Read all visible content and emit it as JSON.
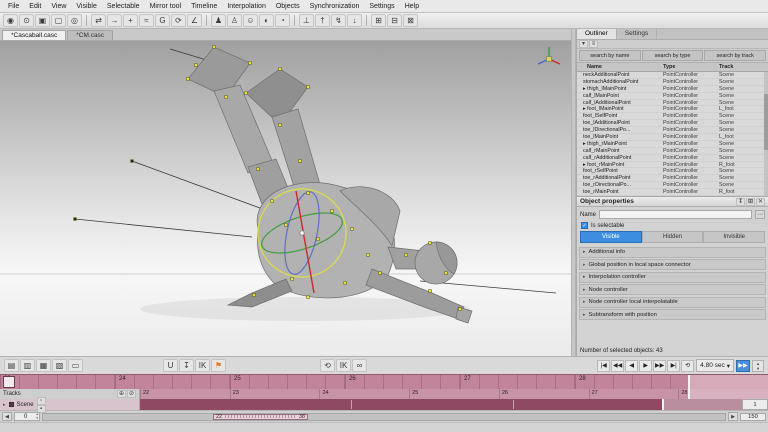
{
  "icons": {
    "chevron": "▸",
    "check": "✓",
    "ellipsis": "⋯",
    "dropdown": "▾",
    "up": "▴",
    "down": "▾",
    "left": "◀",
    "right": "▶"
  },
  "menu": {
    "items": [
      "File",
      "Edit",
      "View",
      "Visible",
      "Selectable",
      "Mirror tool",
      "Timeline",
      "Interpolation",
      "Objects",
      "Synchronization",
      "Settings",
      "Help"
    ]
  },
  "toolbar": {
    "icons": [
      {
        "name": "select-point-mode",
        "glyph": "◉"
      },
      {
        "name": "select-sphere-mode",
        "glyph": "⊙"
      },
      {
        "name": "select-box-mode",
        "glyph": "▣"
      },
      {
        "name": "select-rect-mode",
        "glyph": "▢"
      },
      {
        "name": "camera-view",
        "glyph": "◎"
      },
      {
        "sep": true
      },
      {
        "name": "interval-edit",
        "glyph": "⇄"
      },
      {
        "name": "arrow-select",
        "glyph": "→"
      },
      {
        "name": "move-tool",
        "glyph": "+"
      },
      {
        "name": "trajectory-tool",
        "glyph": "≈"
      },
      {
        "name": "graph-editor",
        "glyph": "G"
      },
      {
        "name": "rotate-tool",
        "glyph": "⟳"
      },
      {
        "name": "angle-snap",
        "glyph": "∠"
      },
      {
        "sep": true
      },
      {
        "name": "pose-mode",
        "glyph": "♟"
      },
      {
        "name": "character-mode",
        "glyph": "♙"
      },
      {
        "name": "ghost-skin",
        "glyph": "☺"
      },
      {
        "name": "mirror-pose",
        "glyph": "◐"
      },
      {
        "name": "onion-skin",
        "glyph": "◔"
      },
      {
        "sep": true
      },
      {
        "name": "ground-contact",
        "glyph": "⊥"
      },
      {
        "name": "tpose-reset",
        "glyph": "†"
      },
      {
        "name": "physics-sim",
        "glyph": "↯"
      },
      {
        "name": "gravity-drop",
        "glyph": "↓"
      },
      {
        "sep": true
      },
      {
        "name": "panel-layout-a",
        "glyph": "⊞"
      },
      {
        "name": "panel-layout-b",
        "glyph": "⊟"
      },
      {
        "name": "panel-layout-c",
        "glyph": "⊠"
      }
    ]
  },
  "tabs": [
    {
      "label": "*Cascaball.casc",
      "active": true
    },
    {
      "label": "*CM.casc",
      "active": false
    }
  ],
  "outliner": {
    "tabs": [
      "Outliner",
      "Settings"
    ],
    "toolbar_icons": [
      {
        "name": "filter-menu",
        "glyph": "▾"
      },
      {
        "name": "view-options",
        "glyph": "≡"
      }
    ],
    "search_buttons": [
      "search by name",
      "search by type",
      "search by track"
    ],
    "columns": [
      "Name",
      "Type",
      "Track"
    ],
    "rows": [
      {
        "arrow": "",
        "name": "neckAdditionalPoint",
        "type": "PointController",
        "track": "Scene"
      },
      {
        "arrow": "",
        "name": "stomachAdditionalPoint",
        "type": "PointController",
        "track": "Scene"
      },
      {
        "arrow": "▸",
        "name": "thigh_lMainPoint",
        "type": "PointController",
        "track": "Scene"
      },
      {
        "arrow": "",
        "name": "calf_lMainPoint",
        "type": "PointController",
        "track": "Scene"
      },
      {
        "arrow": "",
        "name": "calf_lAdditionalPoint",
        "type": "PointController",
        "track": "Scene"
      },
      {
        "arrow": "▸",
        "name": "foot_lMainPoint",
        "type": "PointController",
        "track": "L_foot"
      },
      {
        "arrow": "",
        "name": "foot_lSelfPoint",
        "type": "PointController",
        "track": "Scene"
      },
      {
        "arrow": "",
        "name": "toe_lAdditionalPoint",
        "type": "PointController",
        "track": "Scene"
      },
      {
        "arrow": "",
        "name": "toe_lDirectionalPo...",
        "type": "PointController",
        "track": "Scene"
      },
      {
        "arrow": "",
        "name": "toe_lMainPoint",
        "type": "PointController",
        "track": "L_foot"
      },
      {
        "arrow": "▸",
        "name": "thigh_rMainPoint",
        "type": "PointController",
        "track": "Scene"
      },
      {
        "arrow": "",
        "name": "calf_rMainPoint",
        "type": "PointController",
        "track": "Scene"
      },
      {
        "arrow": "",
        "name": "calf_rAdditionalPoint",
        "type": "PointController",
        "track": "Scene"
      },
      {
        "arrow": "▸",
        "name": "foot_rMainPoint",
        "type": "PointController",
        "track": "R_foot"
      },
      {
        "arrow": "",
        "name": "foot_rSelfPoint",
        "type": "PointController",
        "track": "Scene"
      },
      {
        "arrow": "",
        "name": "toe_rAdditionalPoint",
        "type": "PointController",
        "track": "Scene"
      },
      {
        "arrow": "",
        "name": "toe_rDirectionalPo...",
        "type": "PointController",
        "track": "Scene"
      },
      {
        "arrow": "",
        "name": "toe_rMainPoint",
        "type": "PointController",
        "track": "R_foot"
      }
    ]
  },
  "properties": {
    "title": "Object properties",
    "header_icons": [
      {
        "name": "pin-panel",
        "glyph": "↧"
      },
      {
        "name": "float-panel",
        "glyph": "⊞"
      },
      {
        "name": "close-panel",
        "glyph": "✕"
      }
    ],
    "name_label": "Name",
    "name_value": "",
    "selectable_label": "Is selectable",
    "visibility": [
      {
        "label": "Visible",
        "active": true
      },
      {
        "label": "Hidden",
        "active": false
      },
      {
        "label": "Invisible",
        "active": false
      }
    ],
    "sections": [
      "Additional info",
      "Global position in local space connector",
      "Interpolation controller",
      "Node controller",
      "Node controller local interpolatable",
      "Subtransform with position"
    ],
    "count": "Number of selected objects: 43"
  },
  "timeline": {
    "left_icons": [
      {
        "name": "add-track",
        "glyph": "▤"
      },
      {
        "name": "add-track-group",
        "glyph": "▥"
      },
      {
        "name": "duplicate-track",
        "glyph": "▦"
      },
      {
        "name": "delete-track",
        "glyph": "▧"
      },
      {
        "name": "open-scene-folder",
        "glyph": "▭"
      }
    ],
    "center_icons": [
      {
        "name": "magnet-snap",
        "glyph": "U"
      },
      {
        "name": "pin-track",
        "glyph": "↧"
      },
      {
        "name": "ik-mode",
        "glyph": "IK"
      },
      {
        "name": "flag-marker",
        "glyph": "⚑",
        "color": "#e07820"
      }
    ],
    "mid_icons": [
      {
        "name": "loop-interval",
        "glyph": "⟲"
      },
      {
        "name": "ik-interval",
        "glyph": "IK"
      },
      {
        "name": "link-interval",
        "glyph": "∞"
      }
    ],
    "playback": [
      {
        "name": "jump-to-start",
        "glyph": "|◀"
      },
      {
        "name": "previous-keyframe",
        "glyph": "◀◀"
      },
      {
        "name": "step-back",
        "glyph": "◀"
      },
      {
        "name": "play",
        "glyph": "▶"
      },
      {
        "name": "step-forward",
        "glyph": "▶▶"
      },
      {
        "name": "next-keyframe",
        "glyph": "▶|"
      },
      {
        "name": "loop-playback",
        "glyph": "⟲"
      }
    ],
    "time_display": "4.80 sec",
    "fast_forward_glyph": "▶▶",
    "tracks_label": "Tracks",
    "tracks_head_icons": [
      {
        "name": "add-key",
        "glyph": "⊕"
      },
      {
        "name": "lock-tracks",
        "glyph": "⊘"
      }
    ],
    "scene_label": "Scene",
    "scene_icons": [
      {
        "name": "track-solo",
        "glyph": "▫"
      },
      {
        "name": "track-mute",
        "glyph": "▪"
      }
    ],
    "ruler_frames": [
      "23",
      "24",
      "25",
      "26",
      "27",
      "28"
    ],
    "overview_frames": [
      "22",
      "23",
      "24",
      "25",
      "26",
      "27",
      "28"
    ],
    "range_start": "22",
    "range_end": "38",
    "frame_spin": "0",
    "zoom_top": "1",
    "zoom_bottom": "150"
  }
}
